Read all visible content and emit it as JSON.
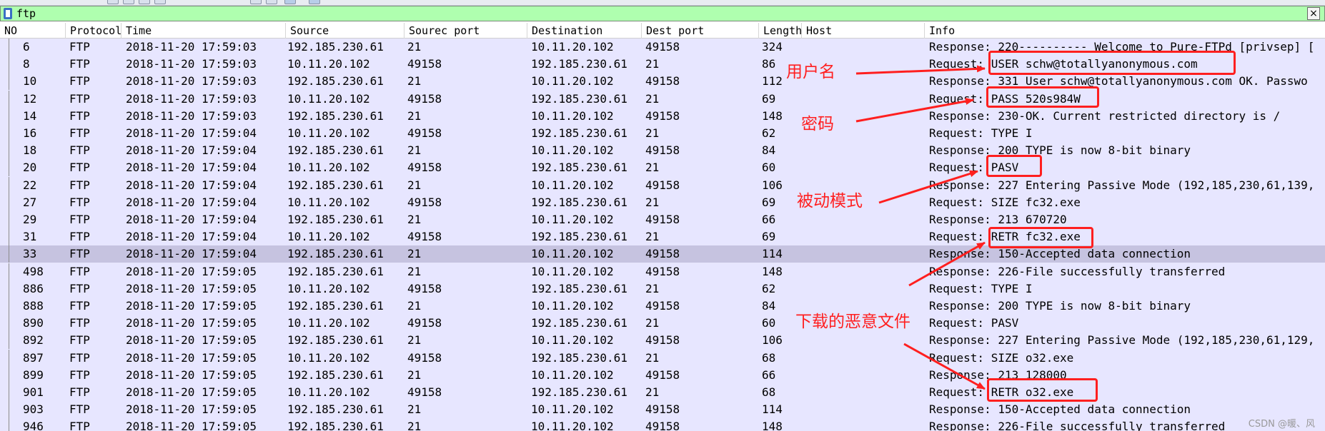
{
  "filter": {
    "text": "ftp",
    "clear_glyph": "×"
  },
  "columns": {
    "no": "NO",
    "protocol": "Protocol",
    "time": "Time",
    "source": "Source",
    "source_port": "Sourec port",
    "destination": "Destination",
    "dest_port": "Dest port",
    "length": "Length",
    "host": "Host",
    "info": "Info"
  },
  "packets": [
    {
      "no": "6",
      "protocol": "FTP",
      "time": "2018-11-20 17:59:03",
      "source": "192.185.230.61",
      "source_port": "21",
      "destination": "10.11.20.102",
      "dest_port": "49158",
      "length": "324",
      "info": "Response: 220---------- Welcome to Pure-FTPd [privsep] ["
    },
    {
      "no": "8",
      "protocol": "FTP",
      "time": "2018-11-20 17:59:03",
      "source": "10.11.20.102",
      "source_port": "49158",
      "destination": "192.185.230.61",
      "dest_port": "21",
      "length": "86",
      "info": "Request: USER schw@totallyanonymous.com"
    },
    {
      "no": "10",
      "protocol": "FTP",
      "time": "2018-11-20 17:59:03",
      "source": "192.185.230.61",
      "source_port": "21",
      "destination": "10.11.20.102",
      "dest_port": "49158",
      "length": "112",
      "info": "Response: 331 User schw@totallyanonymous.com OK. Passwo"
    },
    {
      "no": "12",
      "protocol": "FTP",
      "time": "2018-11-20 17:59:03",
      "source": "10.11.20.102",
      "source_port": "49158",
      "destination": "192.185.230.61",
      "dest_port": "21",
      "length": "69",
      "info": "Request: PASS 520s984W"
    },
    {
      "no": "14",
      "protocol": "FTP",
      "time": "2018-11-20 17:59:03",
      "source": "192.185.230.61",
      "source_port": "21",
      "destination": "10.11.20.102",
      "dest_port": "49158",
      "length": "148",
      "info": "Response: 230-OK. Current restricted directory is /"
    },
    {
      "no": "16",
      "protocol": "FTP",
      "time": "2018-11-20 17:59:04",
      "source": "10.11.20.102",
      "source_port": "49158",
      "destination": "192.185.230.61",
      "dest_port": "21",
      "length": "62",
      "info": "Request: TYPE I"
    },
    {
      "no": "18",
      "protocol": "FTP",
      "time": "2018-11-20 17:59:04",
      "source": "192.185.230.61",
      "source_port": "21",
      "destination": "10.11.20.102",
      "dest_port": "49158",
      "length": "84",
      "info": "Response: 200 TYPE is now 8-bit binary"
    },
    {
      "no": "20",
      "protocol": "FTP",
      "time": "2018-11-20 17:59:04",
      "source": "10.11.20.102",
      "source_port": "49158",
      "destination": "192.185.230.61",
      "dest_port": "21",
      "length": "60",
      "info": "Request: PASV"
    },
    {
      "no": "22",
      "protocol": "FTP",
      "time": "2018-11-20 17:59:04",
      "source": "192.185.230.61",
      "source_port": "21",
      "destination": "10.11.20.102",
      "dest_port": "49158",
      "length": "106",
      "info": "Response: 227 Entering Passive Mode (192,185,230,61,139,"
    },
    {
      "no": "27",
      "protocol": "FTP",
      "time": "2018-11-20 17:59:04",
      "source": "10.11.20.102",
      "source_port": "49158",
      "destination": "192.185.230.61",
      "dest_port": "21",
      "length": "69",
      "info": "Request: SIZE fc32.exe"
    },
    {
      "no": "29",
      "protocol": "FTP",
      "time": "2018-11-20 17:59:04",
      "source": "192.185.230.61",
      "source_port": "21",
      "destination": "10.11.20.102",
      "dest_port": "49158",
      "length": "66",
      "info": "Response: 213 670720"
    },
    {
      "no": "31",
      "protocol": "FTP",
      "time": "2018-11-20 17:59:04",
      "source": "10.11.20.102",
      "source_port": "49158",
      "destination": "192.185.230.61",
      "dest_port": "21",
      "length": "69",
      "info": "Request: RETR fc32.exe"
    },
    {
      "no": "33",
      "protocol": "FTP",
      "time": "2018-11-20 17:59:04",
      "source": "192.185.230.61",
      "source_port": "21",
      "destination": "10.11.20.102",
      "dest_port": "49158",
      "length": "114",
      "info": "Response: 150-Accepted data connection",
      "selected": true
    },
    {
      "no": "498",
      "protocol": "FTP",
      "time": "2018-11-20 17:59:05",
      "source": "192.185.230.61",
      "source_port": "21",
      "destination": "10.11.20.102",
      "dest_port": "49158",
      "length": "148",
      "info": "Response: 226-File successfully transferred"
    },
    {
      "no": "886",
      "protocol": "FTP",
      "time": "2018-11-20 17:59:05",
      "source": "10.11.20.102",
      "source_port": "49158",
      "destination": "192.185.230.61",
      "dest_port": "21",
      "length": "62",
      "info": "Request: TYPE I"
    },
    {
      "no": "888",
      "protocol": "FTP",
      "time": "2018-11-20 17:59:05",
      "source": "192.185.230.61",
      "source_port": "21",
      "destination": "10.11.20.102",
      "dest_port": "49158",
      "length": "84",
      "info": "Response: 200 TYPE is now 8-bit binary"
    },
    {
      "no": "890",
      "protocol": "FTP",
      "time": "2018-11-20 17:59:05",
      "source": "10.11.20.102",
      "source_port": "49158",
      "destination": "192.185.230.61",
      "dest_port": "21",
      "length": "60",
      "info": "Request: PASV"
    },
    {
      "no": "892",
      "protocol": "FTP",
      "time": "2018-11-20 17:59:05",
      "source": "192.185.230.61",
      "source_port": "21",
      "destination": "10.11.20.102",
      "dest_port": "49158",
      "length": "106",
      "info": "Response: 227 Entering Passive Mode (192,185,230,61,129,"
    },
    {
      "no": "897",
      "protocol": "FTP",
      "time": "2018-11-20 17:59:05",
      "source": "10.11.20.102",
      "source_port": "49158",
      "destination": "192.185.230.61",
      "dest_port": "21",
      "length": "68",
      "info": "Request: SIZE o32.exe"
    },
    {
      "no": "899",
      "protocol": "FTP",
      "time": "2018-11-20 17:59:05",
      "source": "192.185.230.61",
      "source_port": "21",
      "destination": "10.11.20.102",
      "dest_port": "49158",
      "length": "66",
      "info": "Response: 213 128000"
    },
    {
      "no": "901",
      "protocol": "FTP",
      "time": "2018-11-20 17:59:05",
      "source": "10.11.20.102",
      "source_port": "49158",
      "destination": "192.185.230.61",
      "dest_port": "21",
      "length": "68",
      "info": "Request: RETR o32.exe"
    },
    {
      "no": "903",
      "protocol": "FTP",
      "time": "2018-11-20 17:59:05",
      "source": "192.185.230.61",
      "source_port": "21",
      "destination": "10.11.20.102",
      "dest_port": "49158",
      "length": "114",
      "info": "Response: 150-Accepted data connection"
    },
    {
      "no": "946",
      "protocol": "FTP",
      "time": "2018-11-20 17:59:05",
      "source": "192.185.230.61",
      "source_port": "21",
      "destination": "10.11.20.102",
      "dest_port": "49158",
      "length": "148",
      "info": "Response: 226-File successfully transferred"
    }
  ],
  "annotations": {
    "color": "#ff1f1f",
    "username_label": "用户名",
    "password_label": "密码",
    "passive_label": "被动模式",
    "malware_label": "下载的恶意文件"
  },
  "watermark": "CSDN @暖、风",
  "colors": {
    "filter_bg": "#afffaf",
    "row_bg": "#e7e6ff",
    "selected_bg": "#c6c3e0"
  }
}
